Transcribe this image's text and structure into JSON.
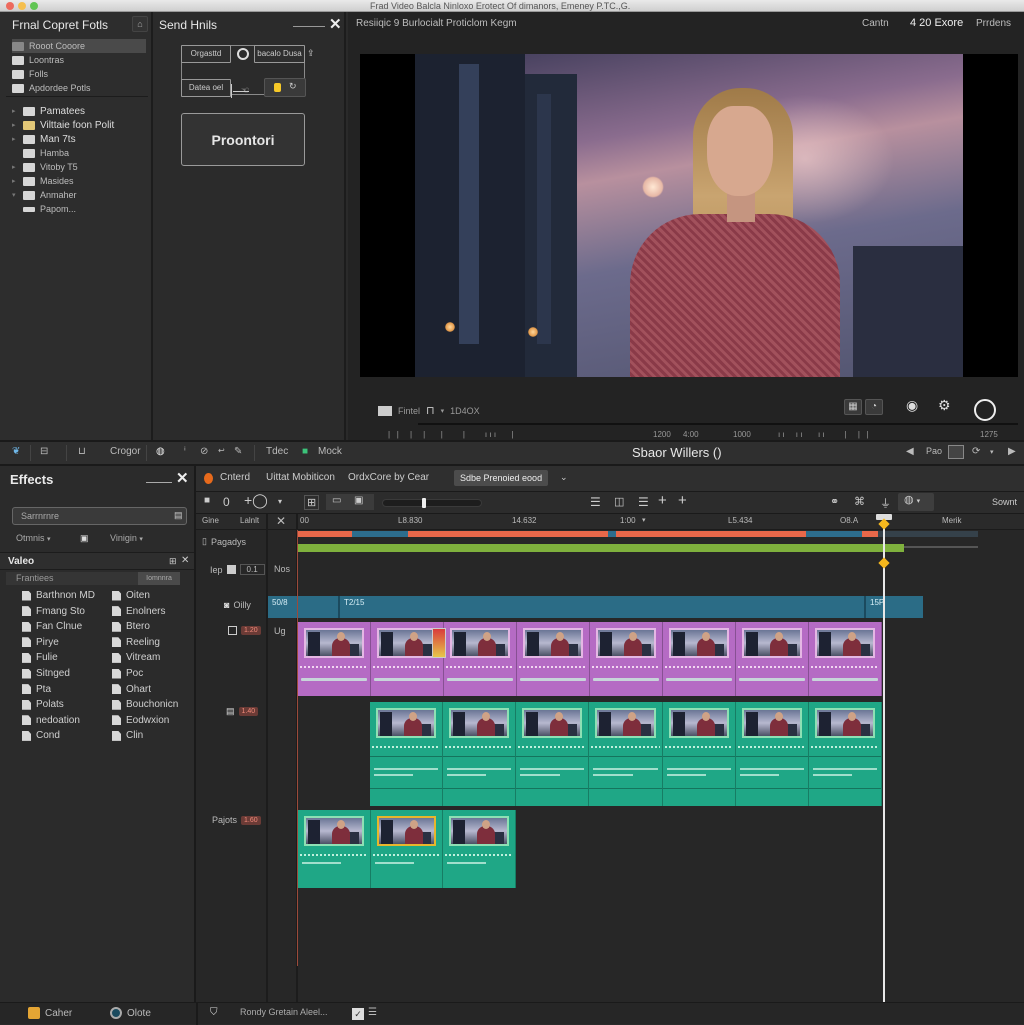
{
  "window": {
    "title": "Frad Video Balcla Ninloxo Erotect Of dimanors, Emeney P.TC.,G.",
    "traffic_colors": [
      "#ed6a5e",
      "#f5bf4f",
      "#61c554"
    ]
  },
  "library": {
    "title": "Frnal Copret Fotls",
    "header_button": "⌂",
    "top_items": [
      {
        "label": "Rooot Cooore",
        "selected": true
      },
      {
        "label": "Loontras"
      },
      {
        "label": "Folls"
      },
      {
        "label": "Apdordee Potls"
      }
    ],
    "tree_items": [
      {
        "label": "Pamatees",
        "bold": true
      },
      {
        "label": "Vilttaie foon Polit",
        "bold": true
      },
      {
        "label": "Man 7ts"
      },
      {
        "label": "Hamba"
      },
      {
        "label": "Vitoby T5"
      },
      {
        "label": "Masides"
      },
      {
        "label": "Anmaher"
      },
      {
        "label": "Papom..."
      }
    ]
  },
  "send_panel": {
    "title": "Send Hnils",
    "buttons": {
      "drganttd": "Orgasttd",
      "bacalo": "bacalo Dusa",
      "datea": "Datea oel"
    },
    "main_button": "Proontori"
  },
  "viewer": {
    "title": "Resiiqic 9 Burlocialt Proticlom Kegm",
    "right_label_1": "Cantn",
    "right_count": "4 20 Exore",
    "right_label_2": "Prrdens",
    "controls": {
      "label1": "Fintel",
      "label2": "1D4OX"
    },
    "ruler": [
      "1200",
      "4:00",
      "1000",
      "1275"
    ]
  },
  "toolbar_strip": {
    "items": [
      "Crogor",
      "Tdec",
      "Mock"
    ],
    "center_title": "Sbaor Willers ()",
    "right_label": "Pao"
  },
  "effects": {
    "title": "Effects",
    "search_placeholder": "Sarrnrnre",
    "dropdown_1": "Otmnis",
    "dropdown_2": "Vinigin",
    "section_title": "Valeo",
    "section_filter": "Frantiees",
    "section_filter_right": "Iomnnra",
    "left_items": [
      "Barthnon MD",
      "Fmang Sto",
      "Fan Clnue",
      "Pirye",
      "Fulie",
      "Sitnged",
      "Pta",
      "Polats",
      "nedoation",
      "Cond"
    ],
    "right_items": [
      "Oiten",
      "Enolners",
      "Btero",
      "Reeling",
      "Vitream",
      "Poc",
      "Ohart",
      "Bouchonicn",
      "Eodwxion",
      "Clin"
    ]
  },
  "timeline": {
    "tabs": [
      {
        "label": "Cnterd"
      },
      {
        "label": "Uittat Mobiticon"
      },
      {
        "label": "OrdxCore by Cear"
      },
      {
        "label": "Sdbe Prenoied eood",
        "active": true
      }
    ],
    "zoom_level": 0.4,
    "search_label": "Sownt",
    "header_labels": {
      "col1": "Gine",
      "col2": "Lalnlt"
    },
    "ruler_ticks": [
      "00",
      "L8.830",
      "14.632",
      "1:00",
      "L5.434",
      "O8.A",
      "Merik"
    ],
    "tracks": [
      {
        "label": "Pagadys"
      },
      {
        "label": "Iep",
        "value": "0.1",
        "sub": "Nos"
      },
      {
        "label": "Oilly",
        "clip_titles": [
          "50/8",
          "T2/15",
          "15P"
        ]
      },
      {
        "label": "Ug",
        "badge": "1.20"
      },
      {
        "label": "",
        "badge": "1.40"
      },
      {
        "label": "Pajots",
        "badge": "1.60"
      }
    ]
  },
  "status_bar": {
    "item1": "Caher",
    "item2": "Olote",
    "item3": "Rondy Gretain Aleel..."
  }
}
